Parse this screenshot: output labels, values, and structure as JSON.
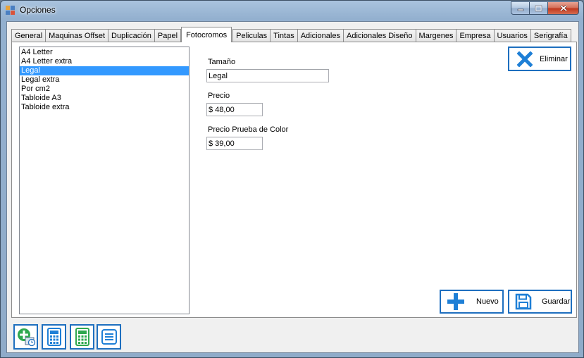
{
  "window": {
    "title": "Opciones",
    "accent": "#1e6fbf",
    "selection_color": "#3399ff"
  },
  "tabs": [
    {
      "label": "General",
      "active": false
    },
    {
      "label": "Maquinas Offset",
      "active": false
    },
    {
      "label": "Duplicación",
      "active": false
    },
    {
      "label": "Papel",
      "active": false
    },
    {
      "label": "Fotocromos",
      "active": true
    },
    {
      "label": "Peliculas",
      "active": false
    },
    {
      "label": "Tintas",
      "active": false
    },
    {
      "label": "Adicionales",
      "active": false
    },
    {
      "label": "Adicionales Diseño",
      "active": false
    },
    {
      "label": "Margenes",
      "active": false
    },
    {
      "label": "Empresa",
      "active": false
    },
    {
      "label": "Usuarios",
      "active": false
    },
    {
      "label": "Serigrafía",
      "active": false
    }
  ],
  "list": {
    "items": [
      "A4 Letter",
      "A4 Letter extra",
      "Legal",
      "Legal extra",
      "Por cm2",
      "Tabloide A3",
      "Tabloide extra"
    ],
    "selected_index": 2
  },
  "form": {
    "size_label": "Tamaño",
    "size_value": "Legal",
    "price_label": "Precio",
    "price_value": "$ 48,00",
    "proof_label": "Precio Prueba de Color",
    "proof_value": "$ 39,00"
  },
  "buttons": {
    "delete": "Eliminar",
    "new": "Nuevo",
    "save": "Guardar"
  },
  "toolbar": [
    {
      "icon": "add-clock-icon"
    },
    {
      "icon": "calculator-blue-icon"
    },
    {
      "icon": "calculator-green-icon"
    },
    {
      "icon": "list-icon"
    }
  ]
}
